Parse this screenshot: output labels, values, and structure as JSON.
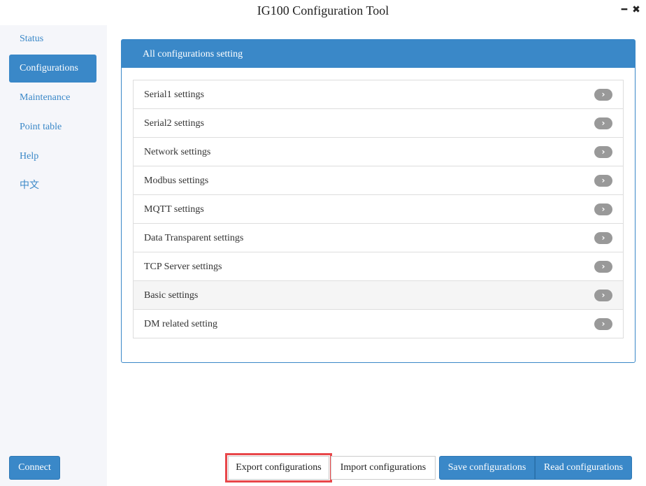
{
  "window": {
    "title": "IG100 Configuration Tool",
    "minimize_icon": "minimize-icon",
    "close_icon": "close-icon"
  },
  "sidebar": {
    "items": [
      {
        "label": "Status",
        "active": false
      },
      {
        "label": "Configurations",
        "active": true
      },
      {
        "label": "Maintenance",
        "active": false
      },
      {
        "label": "Point table",
        "active": false
      },
      {
        "label": "Help",
        "active": false
      },
      {
        "label": "中文",
        "active": false
      }
    ],
    "connect_label": "Connect"
  },
  "panel": {
    "heading": "All configurations setting",
    "items": [
      {
        "label": "Serial1 settings"
      },
      {
        "label": "Serial2 settings"
      },
      {
        "label": "Network settings"
      },
      {
        "label": "Modbus settings"
      },
      {
        "label": "MQTT settings"
      },
      {
        "label": "Data Transparent settings"
      },
      {
        "label": "TCP Server settings"
      },
      {
        "label": "Basic settings"
      },
      {
        "label": "DM related setting"
      }
    ],
    "chevron_glyph": "›"
  },
  "footer": {
    "export_label": "Export configurations",
    "import_label": "Import configurations",
    "save_label": "Save configurations",
    "read_label": "Read configurations"
  },
  "colors": {
    "accent": "#3a88c8",
    "sidebar_bg": "#f5f6fa",
    "highlight": "#e8474a"
  }
}
